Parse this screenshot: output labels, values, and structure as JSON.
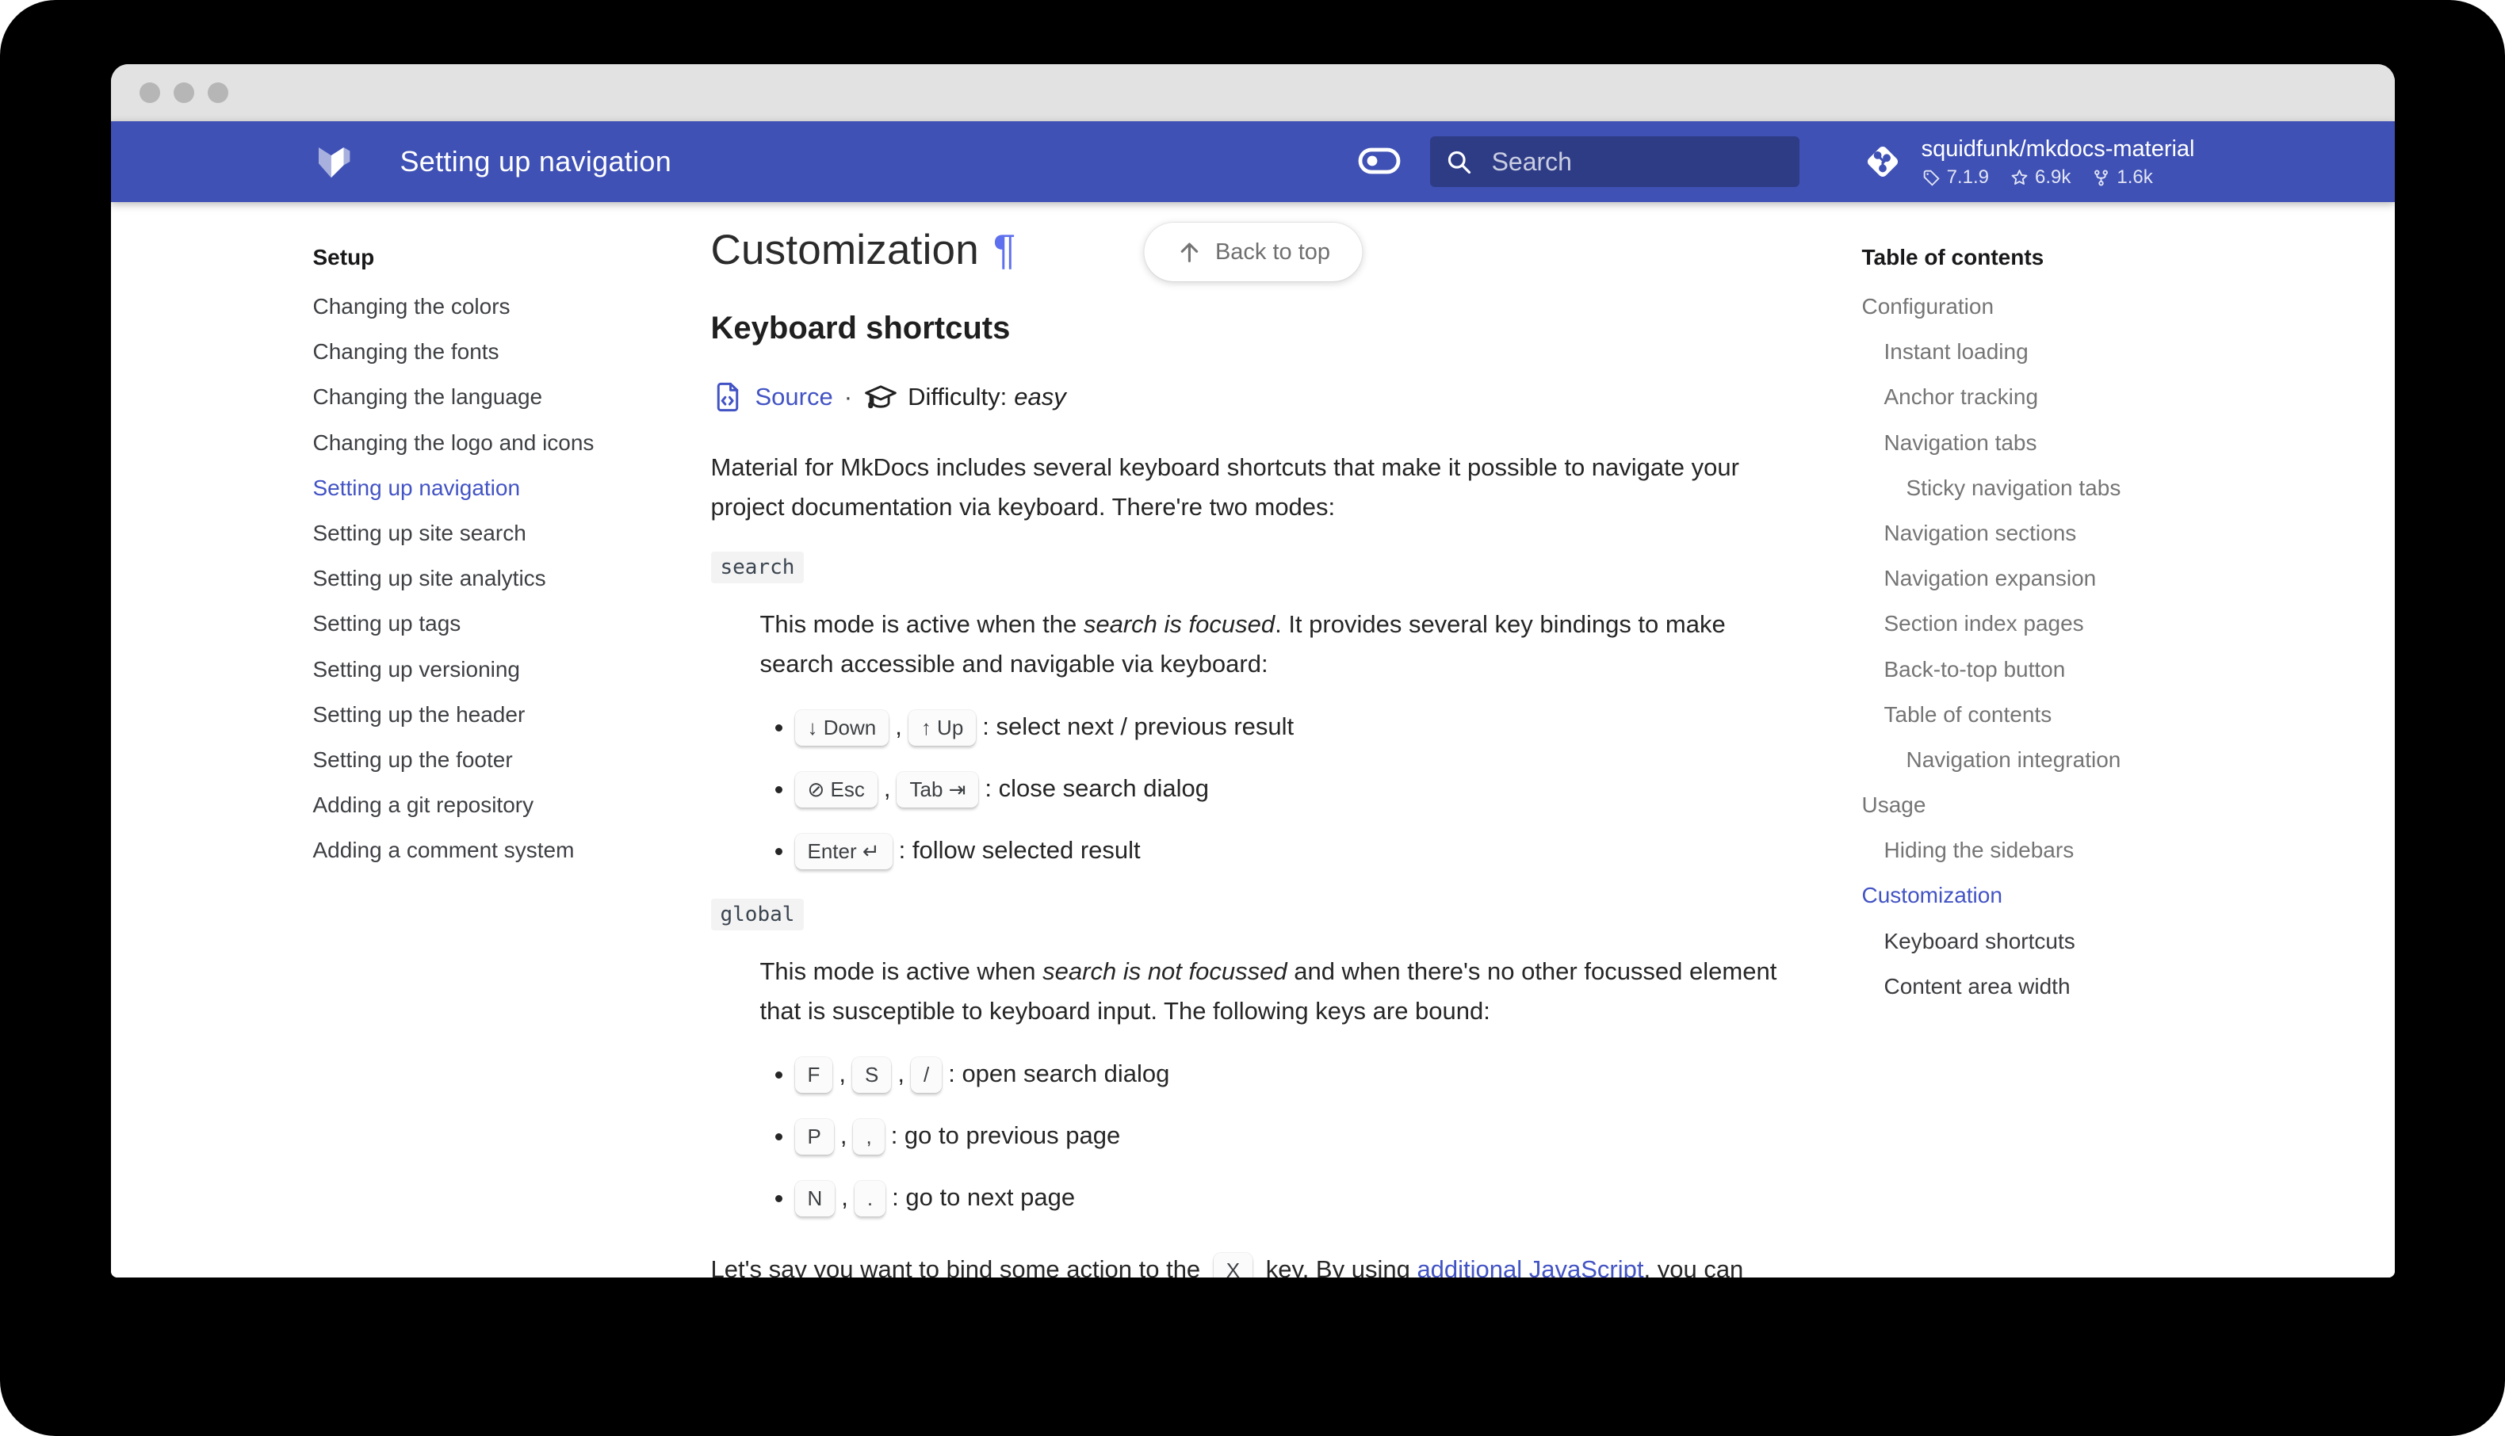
{
  "header": {
    "title": "Setting up navigation",
    "search_placeholder": "Search",
    "repo": {
      "name": "squidfunk/mkdocs-material",
      "version": "7.1.9",
      "stars": "6.9k",
      "forks": "1.6k"
    }
  },
  "icons": {
    "logo": "material-for-mkdocs-logo",
    "toggle": "dark-mode-toggle",
    "search": "magnifier",
    "repo": "git-diamond",
    "version": "tag",
    "stars": "star-outline",
    "forks": "fork",
    "source": "code-file",
    "difficulty": "graduation-cap",
    "back_to_top": "arrow-up"
  },
  "sidebar": {
    "title": "Setup",
    "items": [
      {
        "label": "Changing the colors"
      },
      {
        "label": "Changing the fonts"
      },
      {
        "label": "Changing the language"
      },
      {
        "label": "Changing the logo and icons"
      },
      {
        "label": "Setting up navigation",
        "active": true
      },
      {
        "label": "Setting up site search"
      },
      {
        "label": "Setting up site analytics"
      },
      {
        "label": "Setting up tags"
      },
      {
        "label": "Setting up versioning"
      },
      {
        "label": "Setting up the header"
      },
      {
        "label": "Setting up the footer"
      },
      {
        "label": "Adding a git repository"
      },
      {
        "label": "Adding a comment system"
      }
    ]
  },
  "toc": {
    "title": "Table of contents",
    "items": [
      {
        "label": "Configuration",
        "level": 1,
        "state": "default"
      },
      {
        "label": "Instant loading",
        "level": 2,
        "state": "default"
      },
      {
        "label": "Anchor tracking",
        "level": 2,
        "state": "default"
      },
      {
        "label": "Navigation tabs",
        "level": 2,
        "state": "default"
      },
      {
        "label": "Sticky navigation tabs",
        "level": 3,
        "state": "default"
      },
      {
        "label": "Navigation sections",
        "level": 2,
        "state": "default"
      },
      {
        "label": "Navigation expansion",
        "level": 2,
        "state": "default"
      },
      {
        "label": "Section index pages",
        "level": 2,
        "state": "default"
      },
      {
        "label": "Back-to-top button",
        "level": 2,
        "state": "default"
      },
      {
        "label": "Table of contents",
        "level": 2,
        "state": "default"
      },
      {
        "label": "Navigation integration",
        "level": 3,
        "state": "default"
      },
      {
        "label": "Usage",
        "level": 1,
        "state": "default"
      },
      {
        "label": "Hiding the sidebars",
        "level": 2,
        "state": "default"
      },
      {
        "label": "Customization",
        "level": 1,
        "state": "active"
      },
      {
        "label": "Keyboard shortcuts",
        "level": 2,
        "state": "open"
      },
      {
        "label": "Content area width",
        "level": 2,
        "state": "open"
      }
    ]
  },
  "content": {
    "back_to_top": "Back to top",
    "h1": "Customization",
    "pilcrow": "¶",
    "h2": "Keyboard shortcuts",
    "source_label": "Source",
    "sep": "·",
    "difficulty_label": "Difficulty:",
    "difficulty_value": "easy",
    "intro": "Material for MkDocs includes several keyboard shortcuts that make it possible to navigate your project documentation via keyboard. There're two modes:",
    "modes": [
      {
        "term": "search",
        "desc_pre": "This mode is active when the ",
        "desc_em": "search is focused",
        "desc_post": ". It provides several key bindings to make search accessible and navigable via keyboard:",
        "shortcuts": [
          {
            "keys": [
              "↓ Down",
              "↑ Up"
            ],
            "action": ": select next / previous result"
          },
          {
            "keys": [
              "⊘ Esc",
              "Tab ⇥"
            ],
            "action": ": close search dialog"
          },
          {
            "keys": [
              "Enter ↵"
            ],
            "action": ": follow selected result"
          }
        ]
      },
      {
        "term": "global",
        "desc_pre": "This mode is active when ",
        "desc_em": "search is not focussed",
        "desc_post": " and when there's no other focussed element that is susceptible to keyboard input. The following keys are bound:",
        "shortcuts": [
          {
            "keys": [
              "F",
              "S",
              "/"
            ],
            "action": ": open search dialog"
          },
          {
            "keys": [
              "P",
              ","
            ],
            "action": ": go to previous page"
          },
          {
            "keys": [
              "N",
              "."
            ],
            "action": ": go to next page"
          }
        ]
      }
    ],
    "outro": {
      "pre": "Let's say you want to bind some action to the ",
      "key": "X",
      "mid": " key. By using ",
      "link": "additional JavaScript",
      "post": ", you can"
    }
  },
  "punct": {
    "comma": ","
  }
}
